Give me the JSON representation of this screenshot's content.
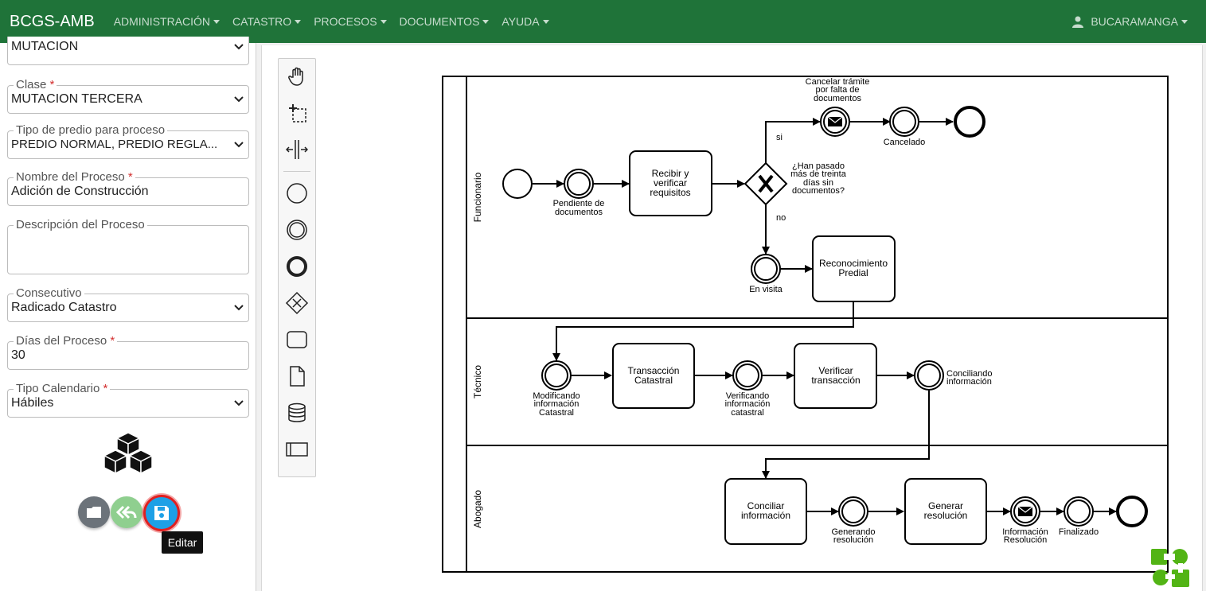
{
  "navbar": {
    "brand": "BCGS-AMB",
    "menu": [
      "ADMINISTRACIÓN",
      "CATASTRO",
      "PROCESOS",
      "DOCUMENTOS",
      "AYUDA"
    ],
    "user": "BUCARAMANGA"
  },
  "form": {
    "tipo_value": "MUTACION",
    "clase_label": "Clase",
    "clase_value": "MUTACION TERCERA",
    "tipo_predio_label": "Tipo de predio para proceso",
    "tipo_predio_value": "PREDIO NORMAL, PREDIO REGLA...",
    "nombre_label": "Nombre del Proceso",
    "nombre_value": "Adición de Construcción",
    "descripcion_label": "Descripción del Proceso",
    "descripcion_value": "",
    "consecutivo_label": "Consecutivo",
    "consecutivo_value": "Radicado Catastro",
    "dias_label": "Días del Proceso",
    "dias_value": "30",
    "calendario_label": "Tipo Calendario",
    "calendario_value": "Hábiles",
    "required_mark": "*"
  },
  "actions": {
    "tooltip": "Editar"
  },
  "palette": [
    "hand-tool",
    "lasso-tool",
    "space-tool",
    "start-event",
    "intermediate-event",
    "end-event",
    "gateway",
    "task",
    "data-object",
    "data-store",
    "pool"
  ],
  "diagram": {
    "lanes": [
      "Funcionario",
      "Técnico",
      "Abogado"
    ],
    "tasks": {
      "recibir": [
        "Recibir y",
        "verificar",
        "requisitos"
      ],
      "reconocimiento": [
        "Reconocimiento",
        "Predial"
      ],
      "transaccion": [
        "Transacción",
        "Catastral"
      ],
      "verificar": [
        "Verificar",
        "transacción"
      ],
      "conciliar": [
        "Conciliar",
        "información"
      ],
      "generar": [
        "Generar",
        "resolución"
      ]
    },
    "events": {
      "pendiente": [
        "Pendiente de",
        "documentos"
      ],
      "cancelar": [
        "Cancelar trámite",
        "por falta de",
        "documentos"
      ],
      "cancelado": [
        "Cancelado"
      ],
      "gateway_q": [
        "¿Han pasado",
        "más de treinta",
        "días sin",
        "documentos?"
      ],
      "si": [
        "si"
      ],
      "no": [
        "no"
      ],
      "en_visita": [
        "En visita"
      ],
      "modificando": [
        "Modificando",
        "información",
        "Catastral"
      ],
      "verificando": [
        "Verificando",
        "información",
        "catastral"
      ],
      "conciliando": [
        "Conciliando",
        "información"
      ],
      "generando": [
        "Generando",
        "resolución"
      ],
      "info_resolucion": [
        "Información",
        "Resolución"
      ],
      "finalizado": [
        "Finalizado"
      ]
    }
  }
}
